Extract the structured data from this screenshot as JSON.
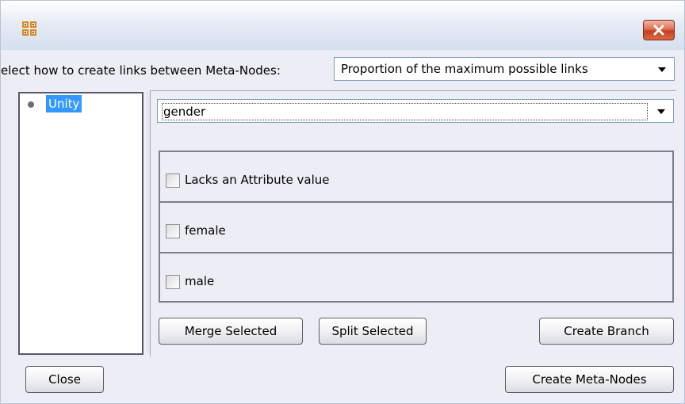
{
  "window": {
    "icon": "network-grid-icon",
    "close_icon": "close-x-icon"
  },
  "links": {
    "label": "elect how to create links between Meta-Nodes:",
    "selected": "Proportion of the maximum possible links"
  },
  "tree": {
    "items": [
      {
        "label": "Unity",
        "selected": true
      }
    ]
  },
  "attribute_select": {
    "selected": "gender"
  },
  "attribute_values": [
    {
      "label": "Lacks an Attribute value",
      "checked": false
    },
    {
      "label": "female",
      "checked": false
    },
    {
      "label": "male",
      "checked": false
    }
  ],
  "buttons": {
    "merge": "Merge Selected",
    "split": "Split Selected",
    "branch": "Create Branch",
    "close": "Close",
    "create": "Create Meta-Nodes"
  },
  "colors": {
    "selection": "#3399ff",
    "close_button": "#d0543a"
  }
}
